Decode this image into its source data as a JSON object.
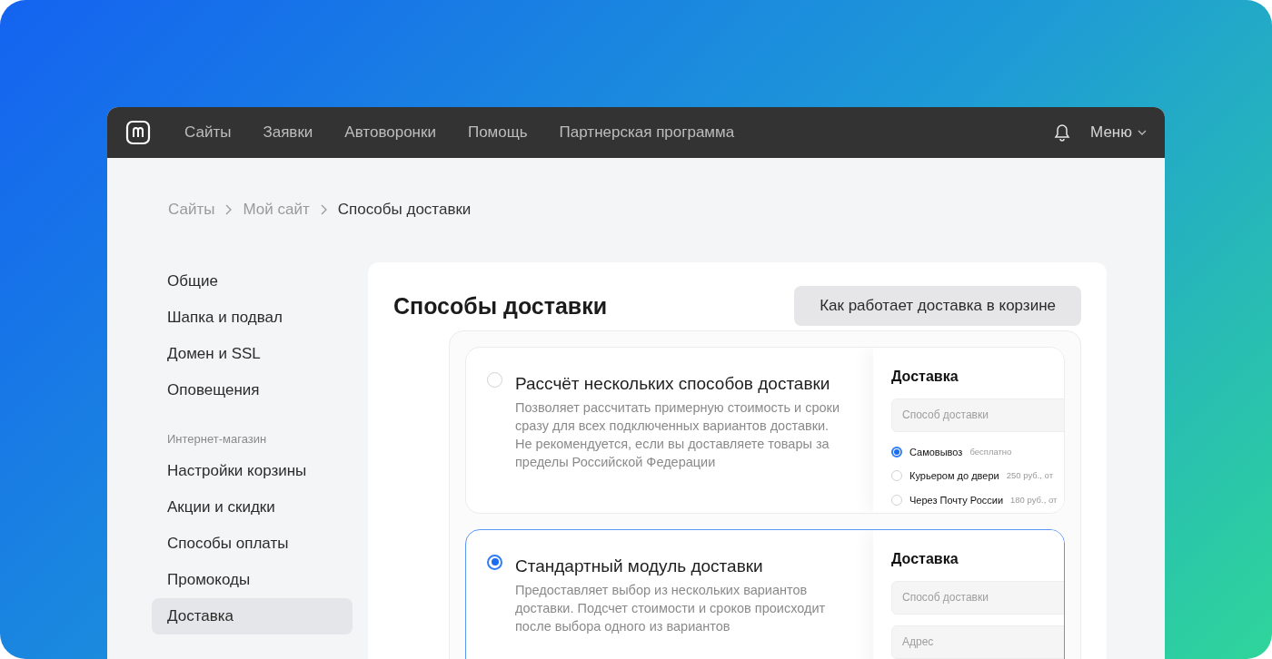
{
  "nav": {
    "items": [
      "Сайты",
      "Заявки",
      "Автоворонки",
      "Помощь",
      "Партнерская программа"
    ],
    "menu": "Меню"
  },
  "breadcrumb": [
    "Сайты",
    "Мой сайт",
    "Способы доставки"
  ],
  "sidebar": {
    "items": [
      {
        "label": "Общие",
        "selected": false
      },
      {
        "label": "Шапка и подвал",
        "selected": false
      },
      {
        "label": "Домен и SSL",
        "selected": false
      },
      {
        "label": "Оповещения",
        "selected": false
      }
    ],
    "section": "Интернет-магазин",
    "shop_items": [
      {
        "label": "Настройки корзины",
        "selected": false
      },
      {
        "label": "Акции и скидки",
        "selected": false
      },
      {
        "label": "Способы оплаты",
        "selected": false
      },
      {
        "label": "Промокоды",
        "selected": false
      },
      {
        "label": "Доставка",
        "selected": true
      }
    ]
  },
  "main": {
    "title": "Способы доставки",
    "help_button": "Как работает доставка в корзине",
    "options": [
      {
        "title": "Рассчёт нескольких способов доставки",
        "description": "Позволяет рассчитать примерную стоимость и сроки сразу для всех подключенных вариантов доставки. Не рекомендуется, если вы доставляете товары за пределы Российской Федерации",
        "selected": false,
        "preview": {
          "title": "Доставка",
          "fields": [
            {
              "placeholder": "Способ доставки"
            }
          ],
          "choices": [
            {
              "label": "Самовывоз",
              "note": "бесплатно",
              "selected": true
            },
            {
              "label": "Курьером до двери",
              "note": "250 руб., от",
              "selected": false
            },
            {
              "label": "Через Почту России",
              "note": "180 руб., от",
              "selected": false
            }
          ]
        }
      },
      {
        "title": "Стандартный модуль доставки",
        "description": "Предоставляет выбор из нескольких вариантов доставки. Подсчет стоимости и сроков происходит после выбора одного из вариантов",
        "selected": true,
        "preview": {
          "title": "Доставка",
          "fields": [
            {
              "placeholder": "Способ доставки"
            },
            {
              "placeholder": "Адрес"
            }
          ]
        }
      }
    ]
  }
}
